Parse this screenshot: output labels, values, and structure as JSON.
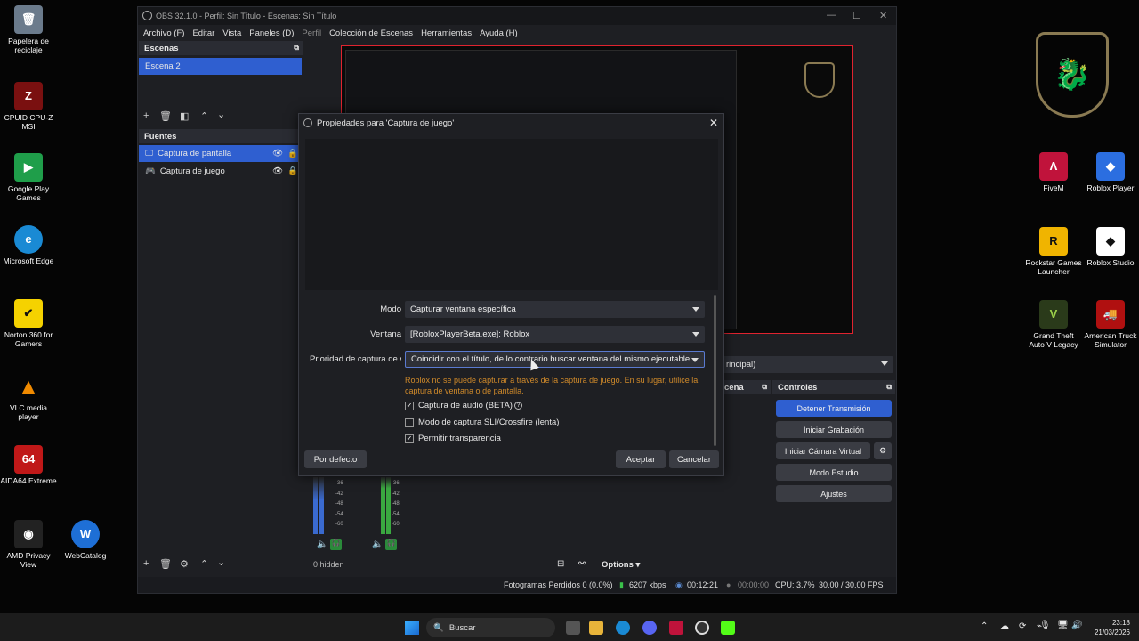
{
  "desktop": {
    "left_icons": [
      {
        "label": "Papelera de reciclaje",
        "icon": "recycle-bin-icon"
      },
      {
        "label": "CPUID CPU-Z MSI",
        "icon": "cpuz-icon"
      },
      {
        "label": "Google Play Games",
        "icon": "google-play-games-icon"
      },
      {
        "label": "Microsoft Edge",
        "icon": "edge-icon"
      },
      {
        "label": "Norton 360 for Gamers",
        "icon": "norton-icon"
      },
      {
        "label": "VLC media player",
        "icon": "vlc-icon"
      },
      {
        "label": "AIDA64 Extreme",
        "icon": "aida64-icon"
      },
      {
        "label": "AMD Privacy View",
        "icon": "amd-privacy-icon"
      },
      {
        "label": "WebCatalog",
        "icon": "webcatalog-icon"
      }
    ],
    "right_icons": [
      {
        "label": "FiveM",
        "icon": "fivem-icon"
      },
      {
        "label": "Roblox Player",
        "icon": "roblox-player-icon"
      },
      {
        "label": "Rockstar Games Launcher",
        "icon": "rockstar-icon"
      },
      {
        "label": "Roblox Studio",
        "icon": "roblox-studio-icon"
      },
      {
        "label": "Grand Theft Auto V Legacy",
        "icon": "gta-icon"
      },
      {
        "label": "American Truck Simulator",
        "icon": "ats-icon"
      }
    ]
  },
  "obs": {
    "title": "OBS 32.1.0 - Perfil: Sin Título - Escenas: Sin Título",
    "menu": [
      "Archivo (F)",
      "Editar",
      "Vista",
      "Paneles (D)",
      "Perfil",
      "Colección de Escenas",
      "Herramientas",
      "Ayuda (H)"
    ],
    "scenes": {
      "header": "Escenas",
      "items": [
        "Escena 2"
      ]
    },
    "sources": {
      "header": "Fuentes",
      "items": [
        "Captura de pantalla",
        "Captura de juego"
      ]
    },
    "transition_select": "rincipal)",
    "transitions_header": "cena",
    "controls": {
      "header": "Controles",
      "buttons": [
        "Detener Transmisión",
        "Iniciar Grabación",
        "Iniciar Cámara Virtual",
        "Modo Estudio",
        "Ajustes"
      ]
    },
    "mixer": {
      "hidden": "0 hidden",
      "options": "Options",
      "db_ticks": [
        "-36",
        "-42",
        "-48",
        "-54",
        "-60"
      ]
    },
    "status": {
      "dropped": "Fotogramas Perdidos 0 (0.0%)",
      "bitrate": "6207 kbps",
      "stream_time": "00:12:21",
      "rec_time": "00:00:00",
      "cpu": "CPU: 3.7%",
      "fps": "30.00 / 30.00 FPS"
    }
  },
  "dialog": {
    "title": "Propiedades para 'Captura de juego'",
    "fields": {
      "mode_label": "Modo",
      "mode_value": "Capturar ventana específica",
      "window_label": "Ventana",
      "window_value": "[RobloxPlayerBeta.exe]: Roblox",
      "priority_label": "Prioridad de captura de ve",
      "priority_value": "Coincidir con el título, de lo contrario buscar ventana del mismo ejecutable"
    },
    "warning": "Roblox no se puede capturar a través de la captura de juego. En su lugar, utilice la captura de ventana o de pantalla.",
    "checkboxes": [
      {
        "label": "Captura de audio (BETA)",
        "checked": true
      },
      {
        "label": "Modo de captura SLI/Crossfire (lenta)",
        "checked": false
      },
      {
        "label": "Permitir transparencia",
        "checked": true
      }
    ],
    "defaults_button": "Por defecto",
    "ok_button": "Aceptar",
    "cancel_button": "Cancelar"
  },
  "taskbar": {
    "search_placeholder": "Buscar",
    "time": "23:18",
    "date": "21/03/2026"
  }
}
